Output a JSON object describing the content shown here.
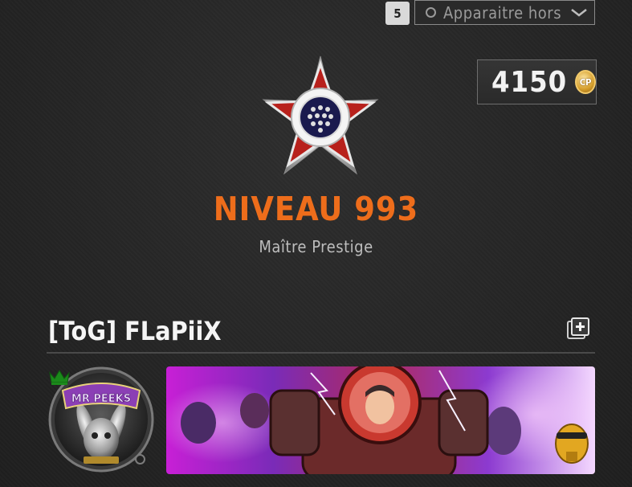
{
  "header": {
    "key_hint": "5",
    "status": {
      "selected": "Apparaitre hors li",
      "icon": "status-circle-icon"
    }
  },
  "currency": {
    "amount": "4150",
    "coin_label": "CP",
    "coin_color": "#d69f2c"
  },
  "rank": {
    "title": "NIVEAU 993",
    "subtitle": "Maître Prestige",
    "accent_color": "#ee6d1b",
    "emblem_icon": "prestige-star-medal-icon"
  },
  "player": {
    "name": "[ToG] FLaPiiX",
    "add_icon": "add-square-icon",
    "crown_icon": "crown-icon",
    "crown_color": "#1b8a1b",
    "avatar_text": "MR PEEKS"
  },
  "banner": {
    "icon": "calling-card-banner",
    "badge_icon": "golden-skull-icon"
  }
}
